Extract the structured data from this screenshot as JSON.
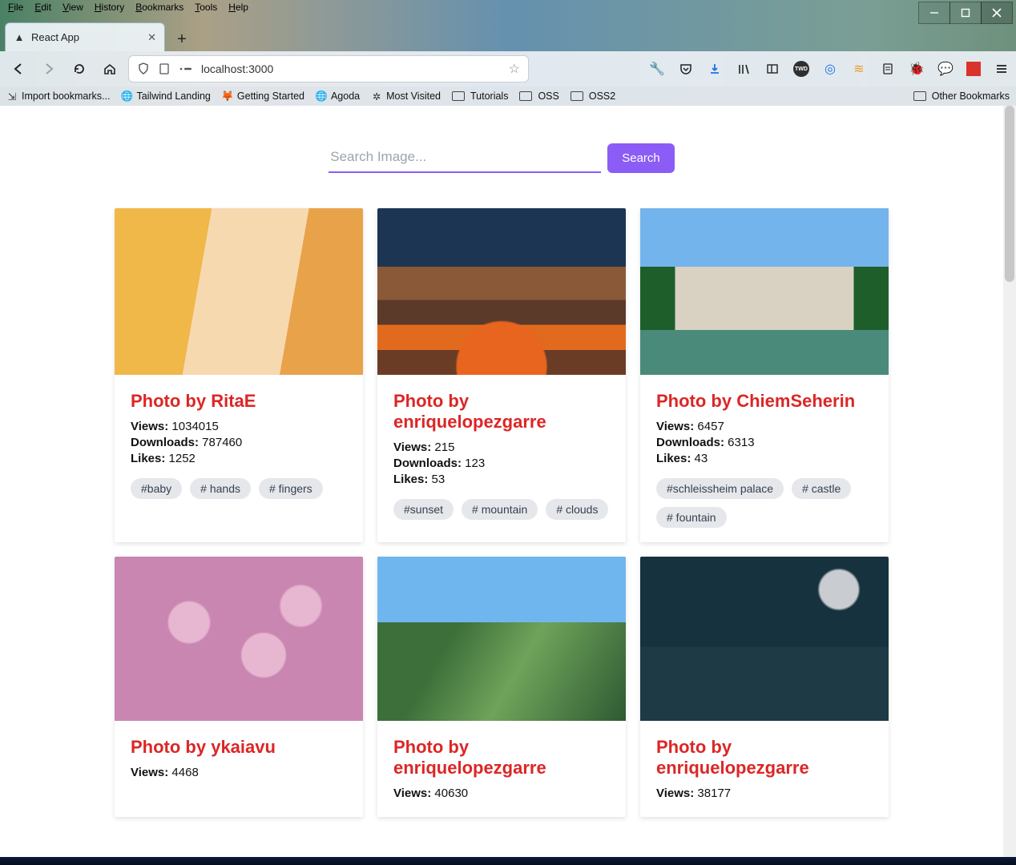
{
  "browser": {
    "menus": [
      "File",
      "Edit",
      "View",
      "History",
      "Bookmarks",
      "Tools",
      "Help"
    ],
    "tab_title": "React App",
    "url": "localhost:3000",
    "bookmarks": [
      {
        "label": "Import bookmarks...",
        "icon": "import"
      },
      {
        "label": "Tailwind Landing",
        "icon": "globe"
      },
      {
        "label": "Getting Started",
        "icon": "firefox"
      },
      {
        "label": "Agoda",
        "icon": "globe"
      },
      {
        "label": "Most Visited",
        "icon": "gear"
      },
      {
        "label": "Tutorials",
        "icon": "folder"
      },
      {
        "label": "OSS",
        "icon": "folder"
      },
      {
        "label": "OSS2",
        "icon": "folder"
      }
    ],
    "other_bookmarks": "Other Bookmarks"
  },
  "app": {
    "search": {
      "placeholder": "Search Image...",
      "button": "Search"
    },
    "labels": {
      "views": "Views:",
      "downloads": "Downloads:",
      "likes": "Likes:",
      "photo_by": "Photo by "
    },
    "cards": [
      {
        "author": "RitaE",
        "views": "1034015",
        "downloads": "787460",
        "likes": "1252",
        "tags": [
          "baby",
          "hands",
          "fingers"
        ],
        "thumb": "art1"
      },
      {
        "author": "enriquelopezgarre",
        "views": "215",
        "downloads": "123",
        "likes": "53",
        "tags": [
          "sunset",
          "mountain",
          "clouds"
        ],
        "thumb": "art2"
      },
      {
        "author": "ChiemSeherin",
        "views": "6457",
        "downloads": "6313",
        "likes": "43",
        "tags": [
          "schleissheim palace",
          "castle",
          "fountain"
        ],
        "thumb": "art3"
      },
      {
        "author": "ykaiavu",
        "views": "4468",
        "downloads": "",
        "likes": "",
        "tags": [],
        "thumb": "art4"
      },
      {
        "author": "enriquelopezgarre",
        "views": "40630",
        "downloads": "",
        "likes": "",
        "tags": [],
        "thumb": "art5"
      },
      {
        "author": "enriquelopezgarre",
        "views": "38177",
        "downloads": "",
        "likes": "",
        "tags": [],
        "thumb": "art6"
      }
    ]
  }
}
